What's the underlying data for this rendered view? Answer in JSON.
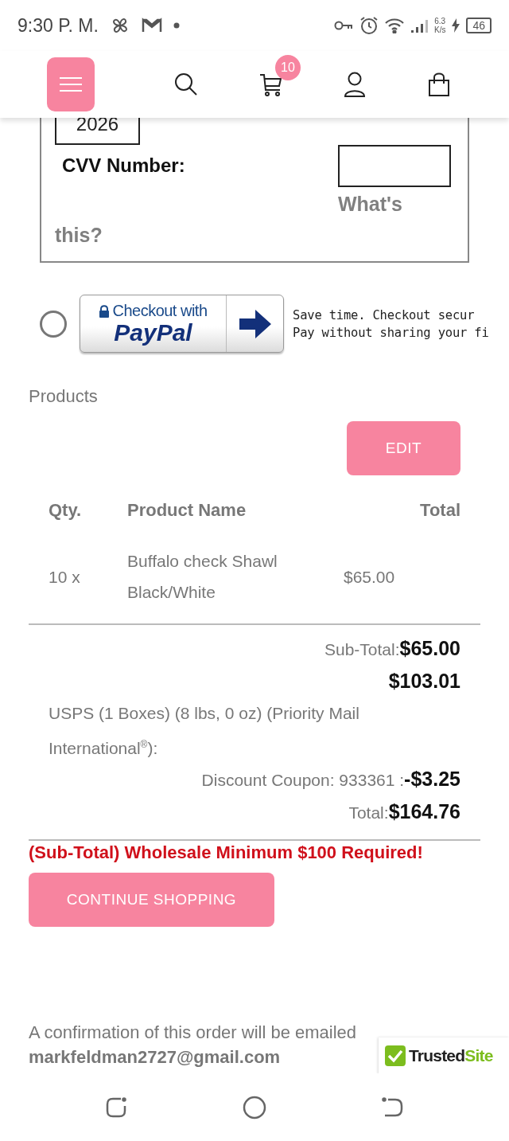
{
  "status_bar": {
    "time": "9:30 P. M.",
    "network_speed": [
      "6.3",
      "K/s"
    ],
    "battery": "46"
  },
  "header": {
    "cart_count": "10"
  },
  "card_form": {
    "expiry_year": "2026",
    "cvv_label": "CVV Number:",
    "cvv_help": "What's this?"
  },
  "paypal_option": {
    "selected": false,
    "button_lines": [
      "Checkout with",
      "PayPal"
    ],
    "description": [
      "Save time. Checkout secur",
      "Pay without sharing your fi"
    ]
  },
  "products": {
    "title": "Products",
    "edit_button": "EDIT",
    "columns": [
      "Qty.",
      "Product Name",
      "Total"
    ],
    "rows": [
      {
        "qty": "10 x",
        "name": "Buffalo check Shawl Black/White",
        "total": "$65.00"
      }
    ]
  },
  "summary": {
    "subtotal": {
      "label": "Sub-Total:",
      "value": "$65.00"
    },
    "shipping": {
      "label": "USPS (1 Boxes) (8 lbs, 0 oz) (Priority Mail International$^{®}$):",
      "value": "$103.01"
    },
    "discount": {
      "label": "Discount Coupon: 933361 :",
      "value": "-$3.25"
    },
    "total": {
      "label": "Total:",
      "value": "$164.76"
    }
  },
  "warning": "(Sub-Total) Wholesale Minimum $100 Required!",
  "continue_button": "CONTINUE SHOPPING",
  "confirmation": {
    "text": "A confirmation of this order will be emailed",
    "email": "markfeldman2727@gmail.com"
  },
  "trust_badge": {
    "brand": [
      "Trusted",
      "Site"
    ]
  }
}
